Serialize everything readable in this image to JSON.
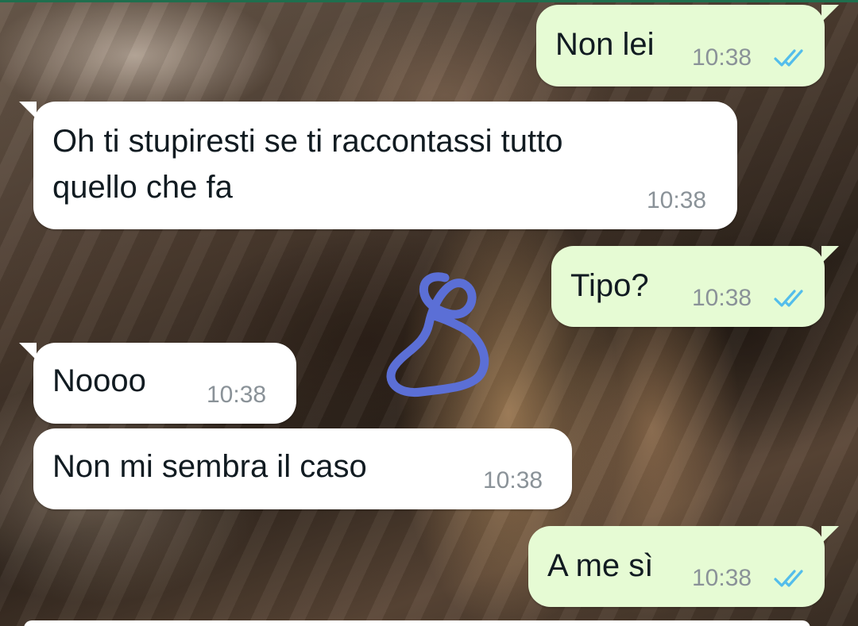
{
  "colors": {
    "outgoing_bubble": "#e6fbd4",
    "incoming_bubble": "#ffffff",
    "read_ticks": "#53bdeb",
    "doodle": "#5b6fd6",
    "timestamp": "#8a9298"
  },
  "icons": {
    "read_receipt": "double-check-icon",
    "doodle": "drawn-figure-eight"
  },
  "messages": [
    {
      "direction": "outgoing",
      "text": "Non lei",
      "time": "10:38",
      "status": "read"
    },
    {
      "direction": "incoming",
      "text_line1": "Oh ti stupiresti se ti raccontassi tutto",
      "text_line2": "quello che fa",
      "time": "10:38"
    },
    {
      "direction": "outgoing",
      "text": "Tipo?",
      "time": "10:38",
      "status": "read"
    },
    {
      "direction": "incoming",
      "text": "Noooo",
      "time": "10:38"
    },
    {
      "direction": "incoming",
      "text": "Non mi sembra il caso",
      "time": "10:38"
    },
    {
      "direction": "outgoing",
      "text": "A me sì",
      "time": "10:38",
      "status": "read"
    }
  ]
}
